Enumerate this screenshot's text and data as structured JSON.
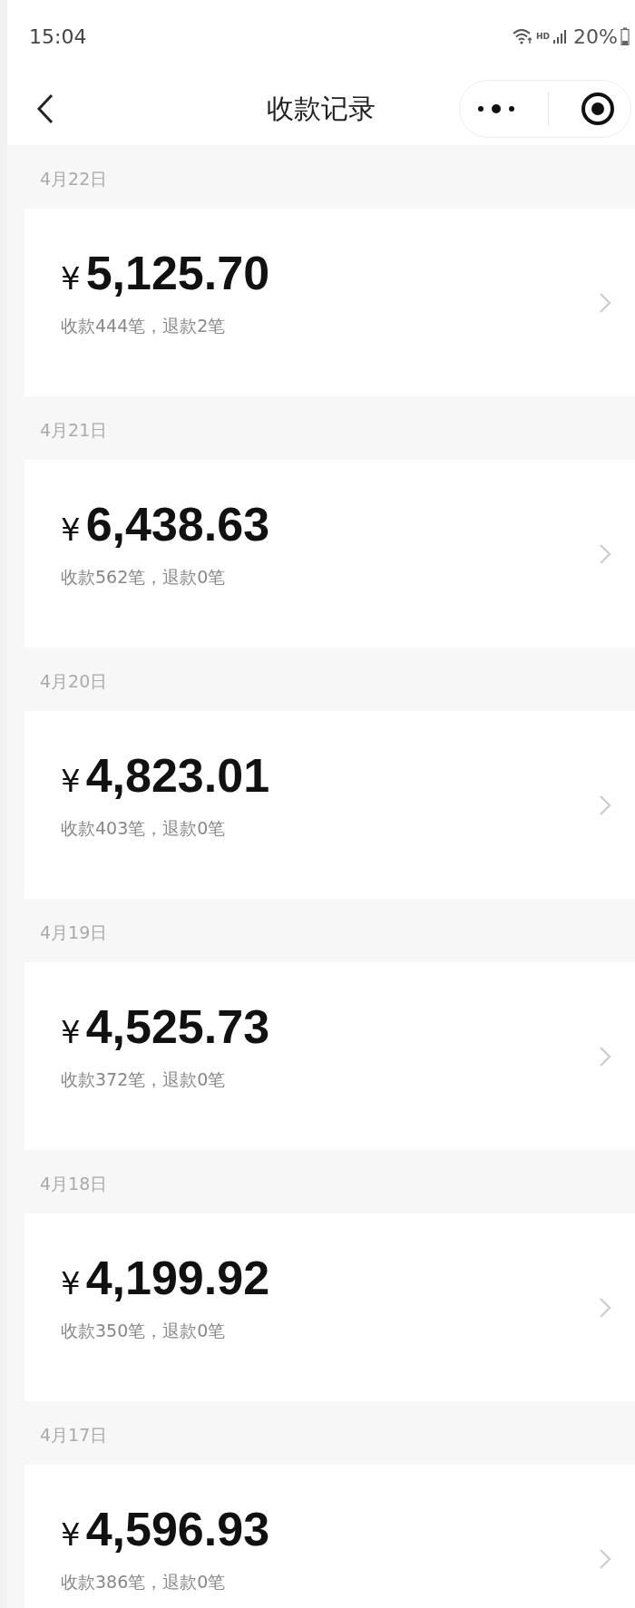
{
  "status_bar": {
    "time": "15:04",
    "network_badge": "HD",
    "battery": "20%"
  },
  "header": {
    "title": "收款记录"
  },
  "records": [
    {
      "date": "4月22日",
      "currency": "¥",
      "amount": "5,125.70",
      "summary": "收款444笔，退款2笔"
    },
    {
      "date": "4月21日",
      "currency": "¥",
      "amount": "6,438.63",
      "summary": "收款562笔，退款0笔"
    },
    {
      "date": "4月20日",
      "currency": "¥",
      "amount": "4,823.01",
      "summary": "收款403笔，退款0笔"
    },
    {
      "date": "4月19日",
      "currency": "¥",
      "amount": "4,525.73",
      "summary": "收款372笔，退款0笔"
    },
    {
      "date": "4月18日",
      "currency": "¥",
      "amount": "4,199.92",
      "summary": "收款350笔，退款0笔"
    },
    {
      "date": "4月17日",
      "currency": "¥",
      "amount": "4,596.93",
      "summary": "收款386笔，退款0笔"
    }
  ]
}
